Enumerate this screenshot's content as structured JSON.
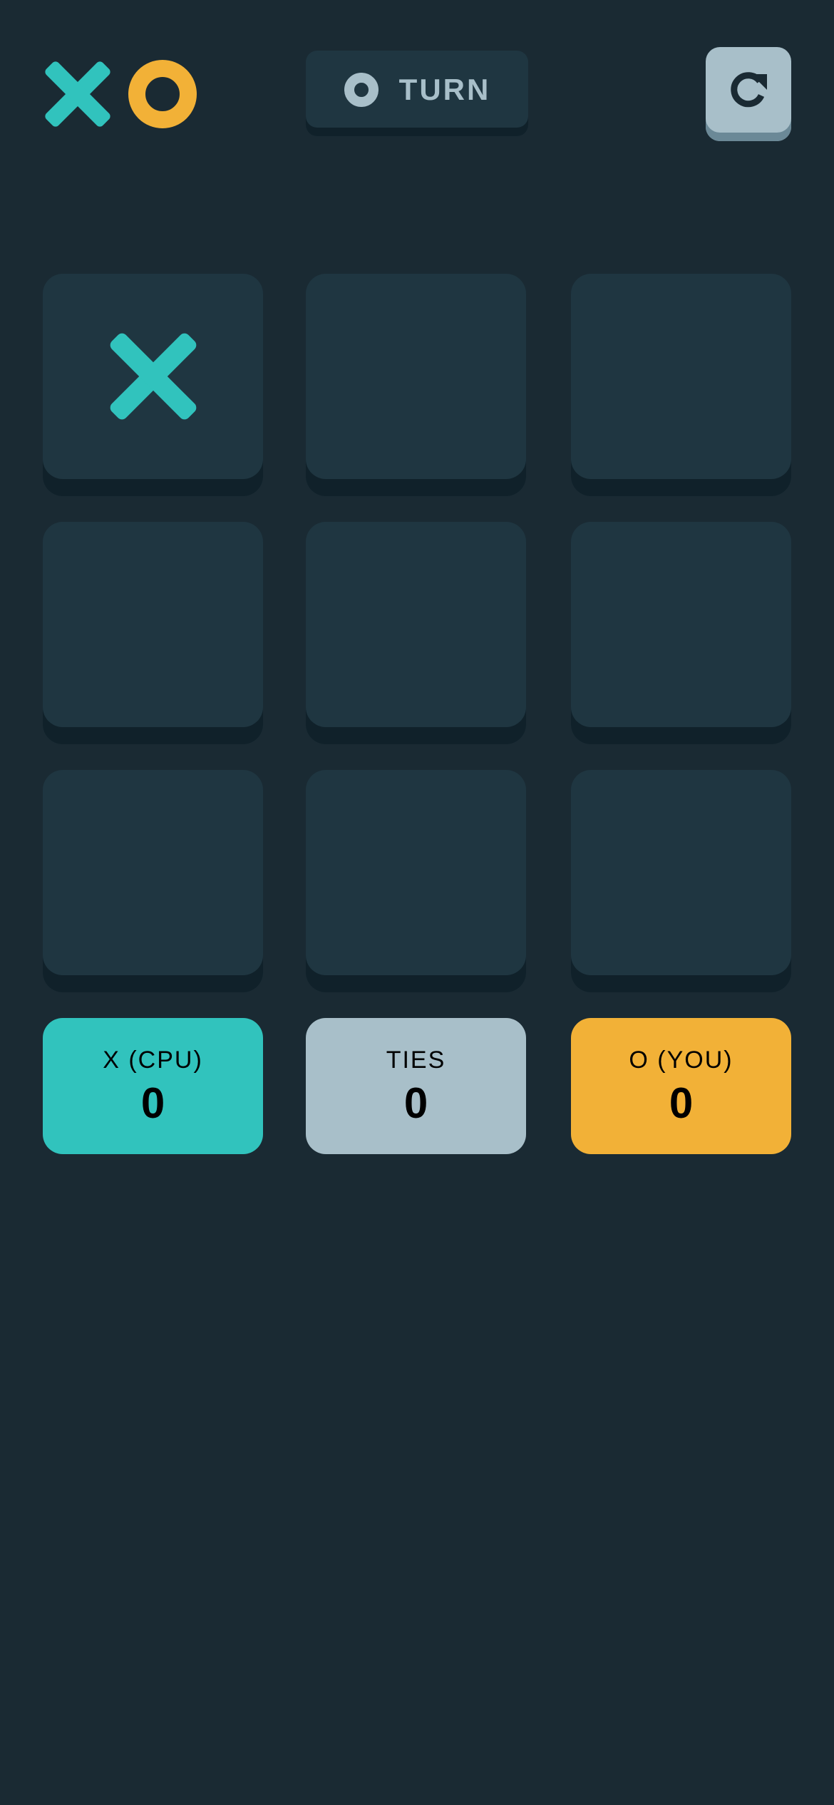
{
  "logo": {
    "icons": [
      "x-icon",
      "o-icon"
    ]
  },
  "turn": {
    "icon": "o-icon",
    "label": "TURN"
  },
  "restart": {
    "icon": "restart-icon"
  },
  "board": {
    "cells": [
      "X",
      "",
      "",
      "",
      "",
      "",
      "",
      "",
      ""
    ]
  },
  "scores": {
    "x": {
      "label": "X (CPU)",
      "value": "0"
    },
    "ties": {
      "label": "TIES",
      "value": "0"
    },
    "o": {
      "label": "O (YOU)",
      "value": "0"
    }
  },
  "colors": {
    "background": "#1A2A33",
    "panel": "#1F3641",
    "x": "#31C3BD",
    "o": "#F2B137",
    "silver": "#A8BFC9"
  }
}
